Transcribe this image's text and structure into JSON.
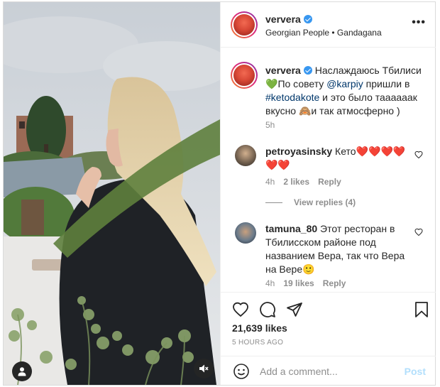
{
  "post": {
    "author": "ververa",
    "location": "Georgian People • Gandagana",
    "caption": {
      "author": "ververa",
      "text_1": " Наслаждаюсь Тбилиси ",
      "emoji_1": "💚",
      "text_2": "По совету ",
      "mention": "@karpiy",
      "text_3": " пришли в ",
      "hashtag": "#ketodakote",
      "text_4": " и это было таааааак вкусно ",
      "emoji_2": "🙈",
      "text_5": "и так атмосферно )",
      "time": "5h"
    },
    "comments": [
      {
        "author": "petroyasinsky",
        "text": " Кето",
        "emoji": "❤️❤️❤️❤️❤️❤️",
        "time": "4h",
        "likes": "2 likes",
        "reply": "Reply",
        "view_replies": "View replies (4)"
      },
      {
        "author": "tamuna_80",
        "text": " Этот ресторан в Тбилисском районе под названием Вера, так что Вера на Вере",
        "emoji": "🙂",
        "time": "4h",
        "likes": "19 likes",
        "reply": "Reply"
      }
    ],
    "likes": "21,639 likes",
    "time_ago": "5 HOURS AGO",
    "add_comment": {
      "placeholder": "Add a comment...",
      "post_label": "Post"
    },
    "icons": {
      "like": "heart-icon",
      "comment": "comment-icon",
      "share": "paper-plane-icon",
      "save": "bookmark-icon",
      "emoji": "smiley-icon",
      "user_tag": "user-icon",
      "mute": "speaker-muted-icon",
      "more": "more-options-icon",
      "verified": "verified-badge-icon"
    },
    "colors": {
      "verified": "#3897f0",
      "link": "#00376b",
      "meta": "#8e8e8e",
      "post_disabled": "#b2dffc"
    }
  }
}
